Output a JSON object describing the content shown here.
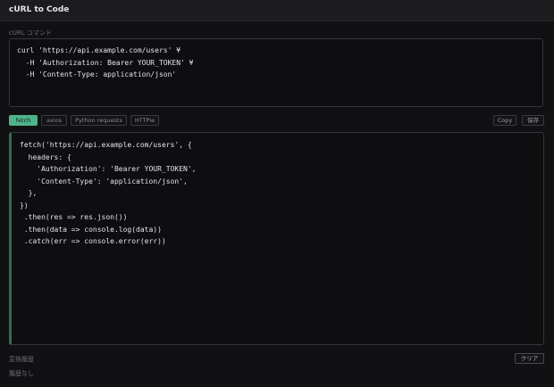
{
  "app": {
    "title": "cURL to Code"
  },
  "input": {
    "label": "cURL コマンド",
    "lines": [
      "curl 'https://api.example.com/users' ¥",
      "  -H 'Authorization: Bearer YOUR_TOKEN' ¥",
      "  -H 'Content-Type: application/json'"
    ]
  },
  "tabs": [
    {
      "label": "fetch",
      "active": true
    },
    {
      "label": "axios",
      "active": false
    },
    {
      "label": "Python requests",
      "active": false
    },
    {
      "label": "HTTPie",
      "active": false
    }
  ],
  "toolbar": {
    "copy_label": "Copy",
    "save_label": "保存"
  },
  "output": {
    "lines": [
      "fetch('https://api.example.com/users', {",
      "  headers: {",
      "    'Authorization': 'Bearer YOUR_TOKEN',",
      "    'Content-Type': 'application/json',",
      "  },",
      "})",
      " .then(res => res.json())",
      " .then(data => console.log(data))",
      " .catch(err => console.error(err))"
    ]
  },
  "history": {
    "label": "変換履歴",
    "clear_label": "クリア",
    "empty_text": "履歴なし"
  },
  "colors": {
    "accent": "#4fb38c",
    "background": "#111113",
    "panel": "#0e0e10"
  }
}
